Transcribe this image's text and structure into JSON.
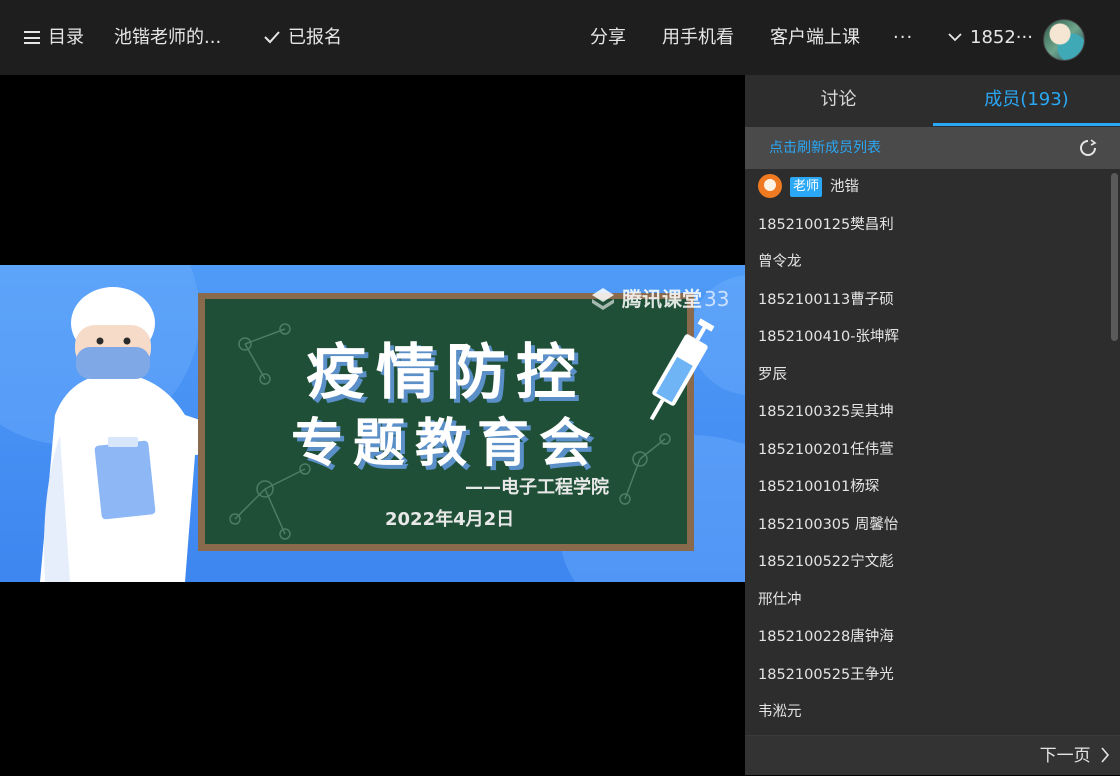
{
  "topbar": {
    "catalog_label": "目录",
    "course_title": "池锴老师的...",
    "enrolled_label": "已报名",
    "share_label": "分享",
    "mobile_label": "用手机看",
    "client_label": "客户端上课",
    "more_label": "···",
    "user_name": "1852···"
  },
  "slide": {
    "watermark": "腾讯课堂",
    "watermark_suffix": "33",
    "title_line1": "疫情防控",
    "title_line2": "专题教育会",
    "department": "——电子工程学院",
    "date": "2022年4月2日"
  },
  "panel": {
    "tabs": [
      {
        "label": "讨论"
      },
      {
        "label": "成员(193)"
      }
    ],
    "refresh_text": "点击刷新成员列表",
    "teacher_badge": "老师",
    "members": [
      "池锴",
      "1852100125樊昌利",
      "曾令龙",
      "1852100113曹子硕",
      "1852100410-张坤辉",
      "罗辰",
      "1852100325吴其坤",
      "1852100201任伟萱",
      "1852100101杨琛",
      "1852100305 周馨怡",
      "1852100522宁文彪",
      "邢仕冲",
      "1852100228唐钟海",
      "1852100525王争光",
      "韦淞元"
    ],
    "next_page": "下一页"
  },
  "colors": {
    "accent": "#2aa7f5",
    "topbar_bg": "#1e1e1e",
    "panel_bg": "#2d2d2d",
    "board_green": "#1f4f37"
  }
}
